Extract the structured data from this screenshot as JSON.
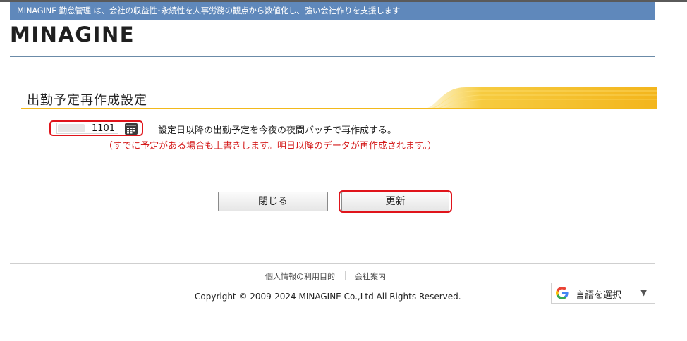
{
  "header": {
    "tagline": "MINAGINE 勤怠管理 は、会社の収益性･永続性を人事労務の観点から数値化し、強い会社作りを支援します",
    "logo": "MINAGINE"
  },
  "section": {
    "title": "出勤予定再作成設定"
  },
  "form": {
    "date_value": "1101",
    "calendar_icon": "calendar-icon",
    "description": "設定日以降の出勤予定を今夜の夜間バッチで再作成する。",
    "warning": "（すでに予定がある場合も上書きします。明日以降のデータが再作成されます。）"
  },
  "buttons": {
    "close_label": "閉じる",
    "update_label": "更新"
  },
  "footer": {
    "links": [
      "個人情報の利用目的",
      "会社案内"
    ],
    "copyright": "Copyright © 2009-2024 MINAGINE Co.,Ltd All Rights Reserved.",
    "translate_label": "言語を選択",
    "translate_arrow": "▼"
  },
  "colors": {
    "tagline_bar": "#5f88bb",
    "accent_orange": "#f2b91c",
    "highlight_red": "#e0141b",
    "warning_text": "#d41a1a"
  }
}
